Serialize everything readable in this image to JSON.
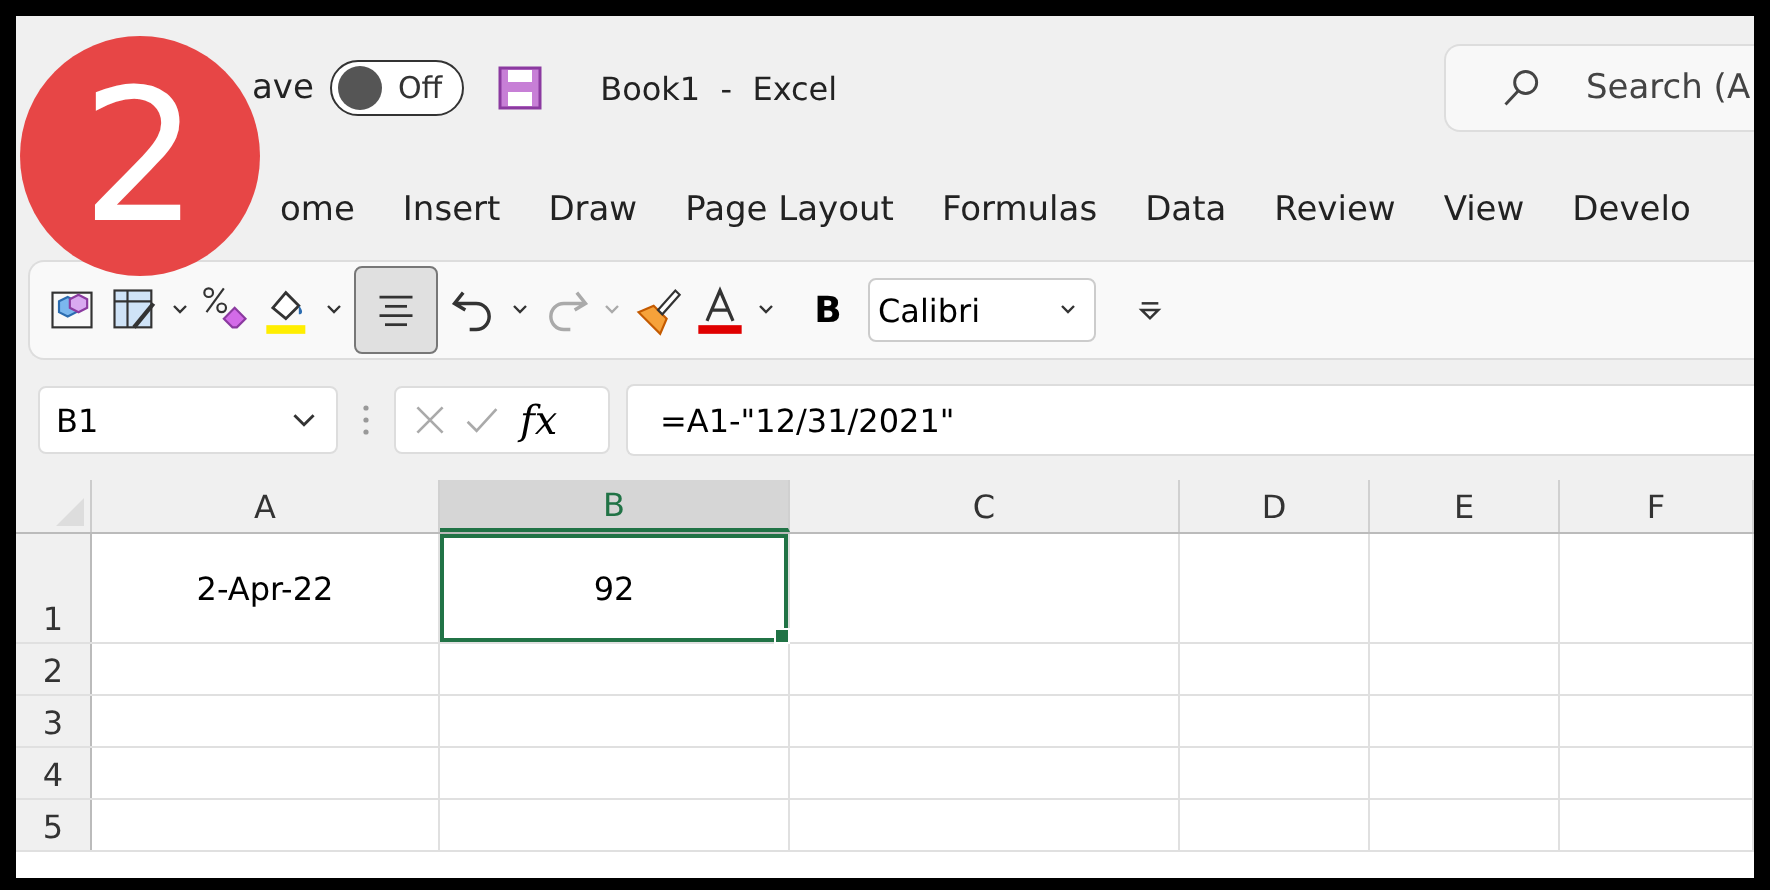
{
  "badge": {
    "text": "2"
  },
  "title_bar": {
    "autosave_label": "ave",
    "toggle": {
      "label": "Off",
      "on": false
    },
    "title": "Book1  -  Excel",
    "search": {
      "placeholder": "Search (A"
    }
  },
  "ribbon_tabs": [
    {
      "label": "ome",
      "selected": false
    },
    {
      "label": "Insert",
      "selected": false
    },
    {
      "label": "Draw",
      "selected": false
    },
    {
      "label": "Page Layout",
      "selected": false
    },
    {
      "label": "Formulas",
      "selected": false
    },
    {
      "label": "Data",
      "selected": false
    },
    {
      "label": "Review",
      "selected": false
    },
    {
      "label": "View",
      "selected": false
    },
    {
      "label": "Develo",
      "selected": false
    }
  ],
  "toolbar": {
    "align_selected": true,
    "bold_label": "B",
    "font": "Calibri"
  },
  "formula_bar": {
    "name_box": "B1",
    "fx_label": "fx",
    "formula": "=A1-\"12/31/2021\""
  },
  "sheet": {
    "columns": [
      {
        "label": "A",
        "selected": false
      },
      {
        "label": "B",
        "selected": true
      },
      {
        "label": "C",
        "selected": false
      },
      {
        "label": "D",
        "selected": false
      },
      {
        "label": "E",
        "selected": false
      },
      {
        "label": "F",
        "selected": false
      }
    ],
    "rows": [
      {
        "label": "1",
        "cells": [
          {
            "text": "2-Apr-22",
            "selected": false
          },
          {
            "text": "92",
            "selected": true
          },
          {
            "selected": false
          },
          {
            "selected": false
          },
          {
            "selected": false
          },
          {
            "selected": false
          }
        ]
      },
      {
        "label": "2",
        "cells": [
          {
            "selected": false
          },
          {
            "selected": false
          },
          {
            "selected": false
          },
          {
            "selected": false
          },
          {
            "selected": false
          },
          {
            "selected": false
          }
        ]
      },
      {
        "label": "3",
        "cells": [
          {
            "selected": false
          },
          {
            "selected": false
          },
          {
            "selected": false
          },
          {
            "selected": false
          },
          {
            "selected": false
          },
          {
            "selected": false
          }
        ]
      },
      {
        "label": "4",
        "cells": [
          {
            "selected": false
          },
          {
            "selected": false
          },
          {
            "selected": false
          },
          {
            "selected": false
          },
          {
            "selected": false
          },
          {
            "selected": false
          }
        ]
      },
      {
        "label": "5",
        "cells": [
          {
            "selected": false
          },
          {
            "selected": false
          },
          {
            "selected": false
          },
          {
            "selected": false
          },
          {
            "selected": false
          },
          {
            "selected": false
          }
        ]
      }
    ]
  }
}
